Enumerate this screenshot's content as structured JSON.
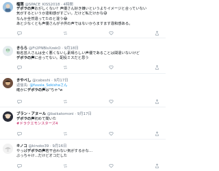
{
  "posts": [
    {
      "name": "榴莲",
      "handle": "@SPACE_KISS2018",
      "date": "4時間",
      "lines": [
        {
          "pre": "",
          "b": "デボラの声",
          "post": "おかしくない？声優さん好き嫌いというよりイメージと合っていない"
        },
        {
          "pre": "",
          "b": "",
          "post": "気がするというか違和感がすごい。だけど私だけかな😅"
        },
        {
          "pre": "",
          "b": "",
          "post": "なんか全然違ってたのと違う😂"
        },
        {
          "pre": "",
          "b": "",
          "post": "あと少なくとも声優さんが子供の声ではないからますます違和感ある。"
        }
      ]
    },
    {
      "name": "きらら",
      "handle": "@Ft2PNBIsXzekO",
      "date": "9月18日",
      "lines": [
        {
          "pre": "",
          "b": "",
          "post": "有名芸人さんは全く悪くないし素晴らしい声優であることは間違いないけど"
        },
        {
          "pre": "",
          "b": "デボラの声",
          "post": "に合ってない。配役ミスだと思う"
        }
      ]
    },
    {
      "name": "きやべし",
      "handle": "@cabeshi",
      "date": "9月17日",
      "lines": [
        {
          "pre": "返信先: ",
          "b": "",
          "post": "@fuusia_Sekishaさん"
        },
        {
          "pre": "確かに",
          "b": "デボラの声",
          "post": "は\"ちゃ\"w"
        }
      ]
    },
    {
      "name": "ブラン・アヌール",
      "handle": "@baikatomoni",
      "date": "9月17日",
      "lines": [
        {
          "pre": "",
          "b": "デボラの声",
          "post": "初めて聞いた"
        },
        {
          "pre": "",
          "b": "",
          "post": "#ドラクエモンスターズ4",
          "tag": true
        }
      ]
    },
    {
      "name": "キノコ",
      "handle": "@kinoko39",
      "date": "9月16日",
      "lines": [
        {
          "pre": "やっぱ",
          "b": "デボラの声",
          "post": "若干合わない気がするかな…"
        },
        {
          "pre": "",
          "b": "",
          "post": "ぶっちゃけ…だけどオコだした"
        }
      ]
    }
  ],
  "icons": {
    "reply": "reply-icon",
    "retweet": "retweet-icon",
    "like": "heart-icon",
    "share": "share-icon"
  },
  "colors": {
    "text": "#0f1419",
    "muted": "#6b7785",
    "hashtag": "#c2185b",
    "divider": "#eef1f4"
  }
}
